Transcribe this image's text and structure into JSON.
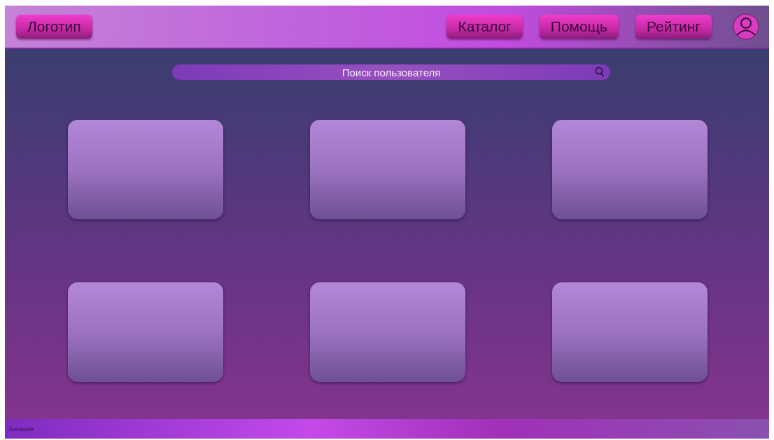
{
  "header": {
    "logo": "Логотип",
    "nav": [
      "Каталог",
      "Помощь",
      "Рейтинг"
    ]
  },
  "search": {
    "placeholder": "Поиск пользователя"
  },
  "cards": [
    {
      "kind": "empty"
    },
    {
      "kind": "empty"
    },
    {
      "kind": "empty"
    },
    {
      "kind": "empty"
    },
    {
      "kind": "empty"
    },
    {
      "kind": "empty"
    }
  ],
  "footer": {
    "text": "Копирайт"
  }
}
